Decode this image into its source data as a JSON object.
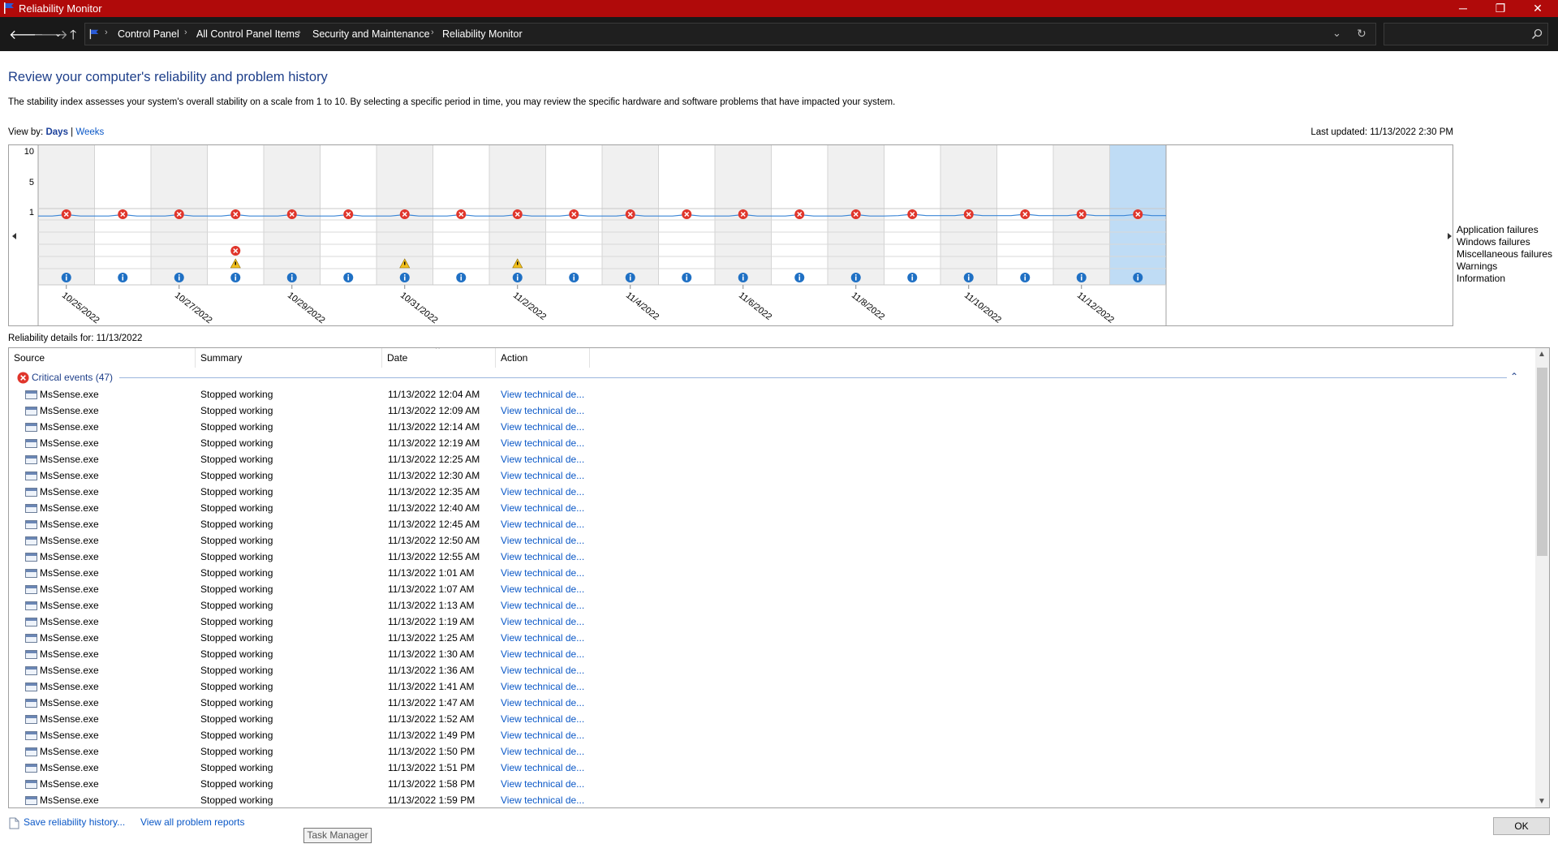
{
  "window": {
    "title": "Reliability Monitor",
    "accent": "#b00a0a",
    "minimize_glyph": "─",
    "restore_glyph": "❐",
    "close_glyph": "✕"
  },
  "address": {
    "breadcrumbs": [
      "Control Panel",
      "All Control Panel Items",
      "Security and Maintenance",
      "Reliability Monitor"
    ],
    "search_placeholder": ""
  },
  "page": {
    "heading": "Review your computer's reliability and problem history",
    "description": "The stability index assesses your system's overall stability on a scale from 1 to 10. By selecting a specific period in time, you may review the specific hardware and software problems that have impacted your system.",
    "view_by_label": "View by:",
    "view_days": "Days",
    "view_sep": " | ",
    "view_weeks": "Weeks",
    "last_updated": "Last updated: 11/13/2022 2:30 PM"
  },
  "chart": {
    "y_ticks": [
      "10",
      "5",
      "1"
    ],
    "legend": [
      "Application failures",
      "Windows failures",
      "Miscellaneous failures",
      "Warnings",
      "Information"
    ],
    "date_labels": [
      "10/25/2022",
      "10/27/2022",
      "10/29/2022",
      "10/31/2022",
      "11/2/2022",
      "11/4/2022",
      "11/6/2022",
      "11/8/2022",
      "11/10/2022",
      "11/12/2022"
    ],
    "app_failure_days": 20,
    "misc_failure_day_index": 3,
    "warning_day_indices": [
      3,
      6,
      8
    ],
    "selected_day_index": 19,
    "colors": {
      "line": "#3b86d6",
      "selected": "#bfdcf5",
      "shade": "#f0f0f0",
      "error": "#e0352b",
      "warning": "#f3c01c",
      "info": "#1f70c4"
    }
  },
  "details": {
    "label": "Reliability details for: 11/13/2022",
    "columns": [
      "Source",
      "Summary",
      "Date",
      "Action"
    ],
    "group_label": "Critical events (47)",
    "rows": [
      {
        "source": "MsSense.exe",
        "summary": "Stopped working",
        "date": "11/13/2022 12:04 AM",
        "action": "View technical de..."
      },
      {
        "source": "MsSense.exe",
        "summary": "Stopped working",
        "date": "11/13/2022 12:09 AM",
        "action": "View technical de..."
      },
      {
        "source": "MsSense.exe",
        "summary": "Stopped working",
        "date": "11/13/2022 12:14 AM",
        "action": "View technical de..."
      },
      {
        "source": "MsSense.exe",
        "summary": "Stopped working",
        "date": "11/13/2022 12:19 AM",
        "action": "View technical de..."
      },
      {
        "source": "MsSense.exe",
        "summary": "Stopped working",
        "date": "11/13/2022 12:25 AM",
        "action": "View technical de..."
      },
      {
        "source": "MsSense.exe",
        "summary": "Stopped working",
        "date": "11/13/2022 12:30 AM",
        "action": "View technical de..."
      },
      {
        "source": "MsSense.exe",
        "summary": "Stopped working",
        "date": "11/13/2022 12:35 AM",
        "action": "View technical de..."
      },
      {
        "source": "MsSense.exe",
        "summary": "Stopped working",
        "date": "11/13/2022 12:40 AM",
        "action": "View technical de..."
      },
      {
        "source": "MsSense.exe",
        "summary": "Stopped working",
        "date": "11/13/2022 12:45 AM",
        "action": "View technical de..."
      },
      {
        "source": "MsSense.exe",
        "summary": "Stopped working",
        "date": "11/13/2022 12:50 AM",
        "action": "View technical de..."
      },
      {
        "source": "MsSense.exe",
        "summary": "Stopped working",
        "date": "11/13/2022 12:55 AM",
        "action": "View technical de..."
      },
      {
        "source": "MsSense.exe",
        "summary": "Stopped working",
        "date": "11/13/2022 1:01 AM",
        "action": "View technical de..."
      },
      {
        "source": "MsSense.exe",
        "summary": "Stopped working",
        "date": "11/13/2022 1:07 AM",
        "action": "View technical de..."
      },
      {
        "source": "MsSense.exe",
        "summary": "Stopped working",
        "date": "11/13/2022 1:13 AM",
        "action": "View technical de..."
      },
      {
        "source": "MsSense.exe",
        "summary": "Stopped working",
        "date": "11/13/2022 1:19 AM",
        "action": "View technical de..."
      },
      {
        "source": "MsSense.exe",
        "summary": "Stopped working",
        "date": "11/13/2022 1:25 AM",
        "action": "View technical de..."
      },
      {
        "source": "MsSense.exe",
        "summary": "Stopped working",
        "date": "11/13/2022 1:30 AM",
        "action": "View technical de..."
      },
      {
        "source": "MsSense.exe",
        "summary": "Stopped working",
        "date": "11/13/2022 1:36 AM",
        "action": "View technical de..."
      },
      {
        "source": "MsSense.exe",
        "summary": "Stopped working",
        "date": "11/13/2022 1:41 AM",
        "action": "View technical de..."
      },
      {
        "source": "MsSense.exe",
        "summary": "Stopped working",
        "date": "11/13/2022 1:47 AM",
        "action": "View technical de..."
      },
      {
        "source": "MsSense.exe",
        "summary": "Stopped working",
        "date": "11/13/2022 1:52 AM",
        "action": "View technical de..."
      },
      {
        "source": "MsSense.exe",
        "summary": "Stopped working",
        "date": "11/13/2022 1:49 PM",
        "action": "View technical de..."
      },
      {
        "source": "MsSense.exe",
        "summary": "Stopped working",
        "date": "11/13/2022 1:50 PM",
        "action": "View technical de..."
      },
      {
        "source": "MsSense.exe",
        "summary": "Stopped working",
        "date": "11/13/2022 1:51 PM",
        "action": "View technical de..."
      },
      {
        "source": "MsSense.exe",
        "summary": "Stopped working",
        "date": "11/13/2022 1:58 PM",
        "action": "View technical de..."
      },
      {
        "source": "MsSense.exe",
        "summary": "Stopped working",
        "date": "11/13/2022 1:59 PM",
        "action": "View technical de..."
      }
    ]
  },
  "footer": {
    "save_link": "Save reliability history...",
    "view_reports_link": "View all problem reports",
    "tooltip": "Task Manager",
    "ok_label": "OK"
  }
}
